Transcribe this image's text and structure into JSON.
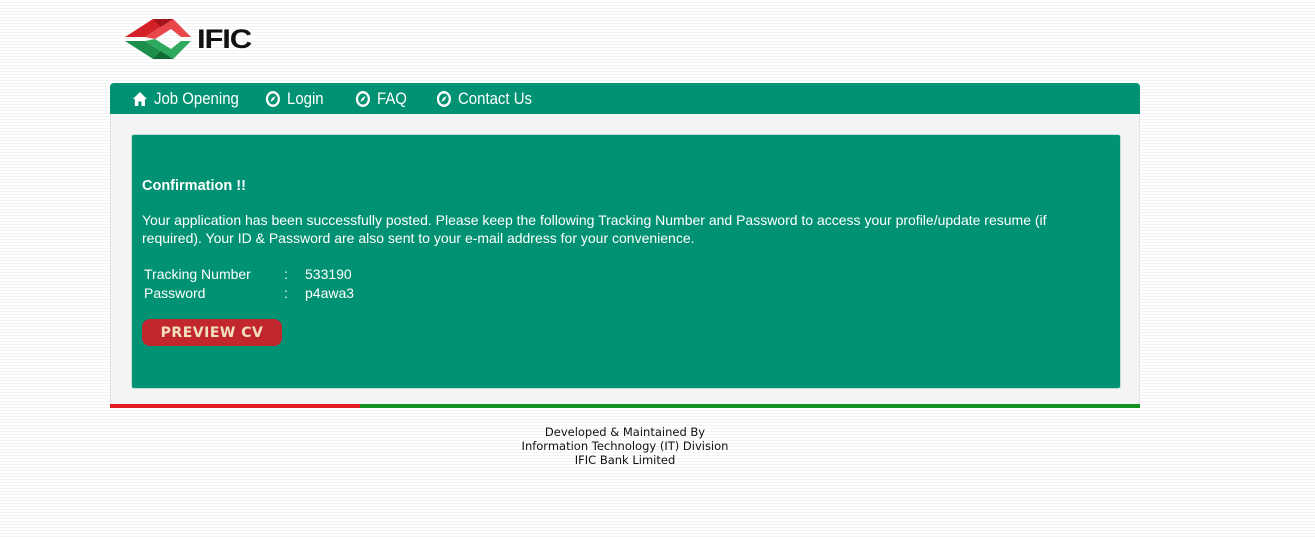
{
  "brand": {
    "logo_text": "IFIC"
  },
  "nav": {
    "items": [
      {
        "label": "Job Opening",
        "icon": "home-icon"
      },
      {
        "label": "Login",
        "icon": "compass-icon"
      },
      {
        "label": "FAQ",
        "icon": "compass-icon"
      },
      {
        "label": "Contact Us",
        "icon": "compass-icon"
      }
    ]
  },
  "confirmation": {
    "title": "Confirmation !!",
    "message": "Your application has been successfully posted. Please keep the following Tracking Number and Password to access your profile/update resume (if required). Your ID & Password are also sent to your e-mail address for your convenience.",
    "tracking_label": "Tracking Number",
    "tracking_value": "533190",
    "password_label": "Password",
    "password_value": "p4awa3",
    "separator": ":",
    "preview_button": "PREVIEW CV"
  },
  "footer": {
    "line1": "Developed & Maintained By",
    "line2": "Information Technology (IT) Division",
    "line3": "IFIC Bank Limited"
  },
  "colors": {
    "primary_green": "#009272",
    "accent_red": "#c1272d",
    "bar_red": "#e31d22",
    "bar_green": "#12921f"
  }
}
